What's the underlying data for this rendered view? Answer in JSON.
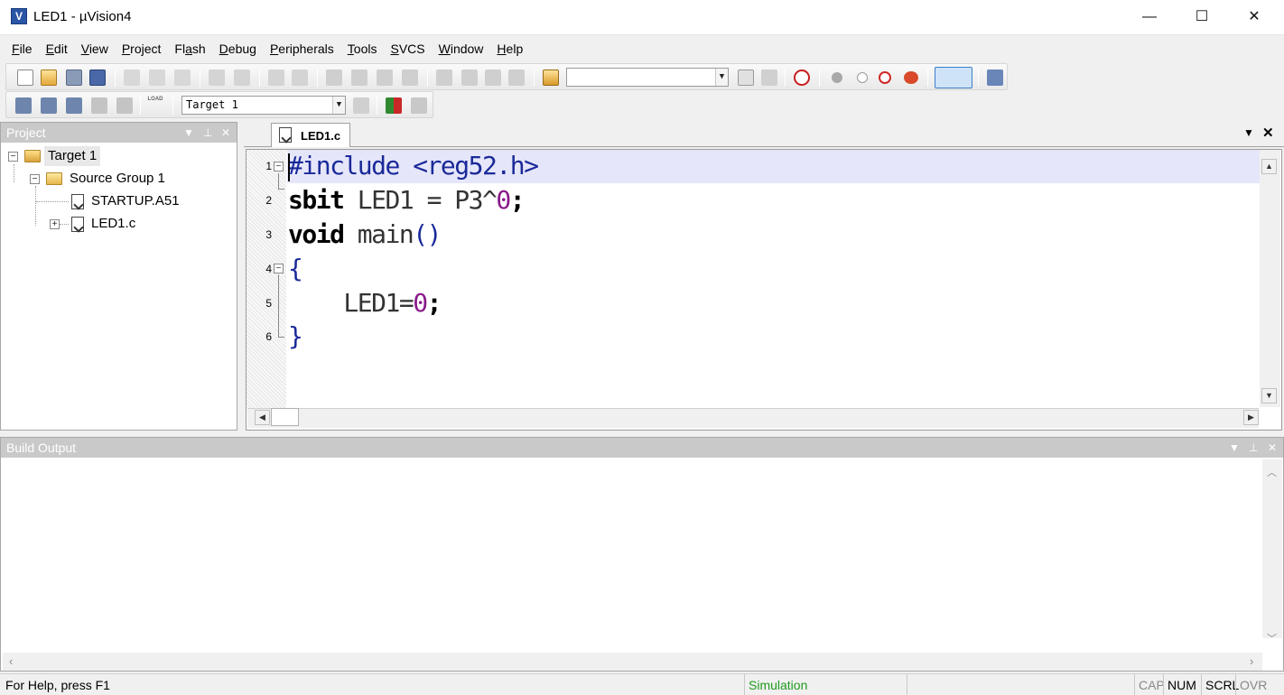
{
  "window": {
    "title": "LED1  - µVision4",
    "app_icon": "V",
    "minimize": "—",
    "maximize": "☐",
    "close": "✕"
  },
  "menu": [
    {
      "label": "File",
      "u": "F",
      "rest": "ile"
    },
    {
      "label": "Edit",
      "u": "E",
      "rest": "dit"
    },
    {
      "label": "View",
      "u": "V",
      "rest": "iew"
    },
    {
      "label": "Project",
      "u": "P",
      "rest": "roject"
    },
    {
      "label": "Flash",
      "pre": "Fl",
      "u": "a",
      "rest": "sh"
    },
    {
      "label": "Debug",
      "u": "D",
      "rest": "ebug"
    },
    {
      "label": "Peripherals",
      "u": "P",
      "rest": "eripherals"
    },
    {
      "label": "Tools",
      "u": "T",
      "rest": "ools"
    },
    {
      "label": "SVCS",
      "u": "S",
      "rest": "VCS"
    },
    {
      "label": "Window",
      "u": "W",
      "rest": "indow"
    },
    {
      "label": "Help",
      "u": "H",
      "rest": "elp"
    }
  ],
  "toolbar2": {
    "target_combo": "Target 1",
    "load_label": "LOAD"
  },
  "project_panel": {
    "title": "Project",
    "tree": {
      "root": "Target 1",
      "group": "Source Group 1",
      "files": [
        "STARTUP.A51",
        "LED1.c"
      ]
    }
  },
  "editor": {
    "tab": "LED1.c",
    "lines": [
      {
        "n": "1",
        "parts": [
          {
            "t": "#include <reg52.h>",
            "c": "pre"
          }
        ]
      },
      {
        "n": "2",
        "parts": [
          {
            "t": "sbit",
            "c": "kw"
          },
          {
            "t": " LED1 = P3^",
            "c": ""
          },
          {
            "t": "0",
            "c": "num"
          },
          {
            "t": ";",
            "c": "kw"
          }
        ]
      },
      {
        "n": "3",
        "parts": [
          {
            "t": "void",
            "c": "kw"
          },
          {
            "t": " main",
            "c": ""
          },
          {
            "t": "()",
            "c": "pre"
          }
        ]
      },
      {
        "n": "4",
        "parts": [
          {
            "t": "{",
            "c": "pre"
          }
        ]
      },
      {
        "n": "5",
        "parts": [
          {
            "t": "    LED1=",
            "c": ""
          },
          {
            "t": "0",
            "c": "num"
          },
          {
            "t": ";",
            "c": "kw"
          }
        ]
      },
      {
        "n": "6",
        "parts": [
          {
            "t": "}",
            "c": "pre"
          }
        ]
      }
    ]
  },
  "build_panel": {
    "title": "Build Output"
  },
  "statusbar": {
    "help": "For Help, press F1",
    "mode": "Simulation",
    "cap": "CAP",
    "num": "NUM",
    "scrl": "SCRL",
    "ovr": "OVR",
    "mode_color": "#1e9a1e"
  }
}
